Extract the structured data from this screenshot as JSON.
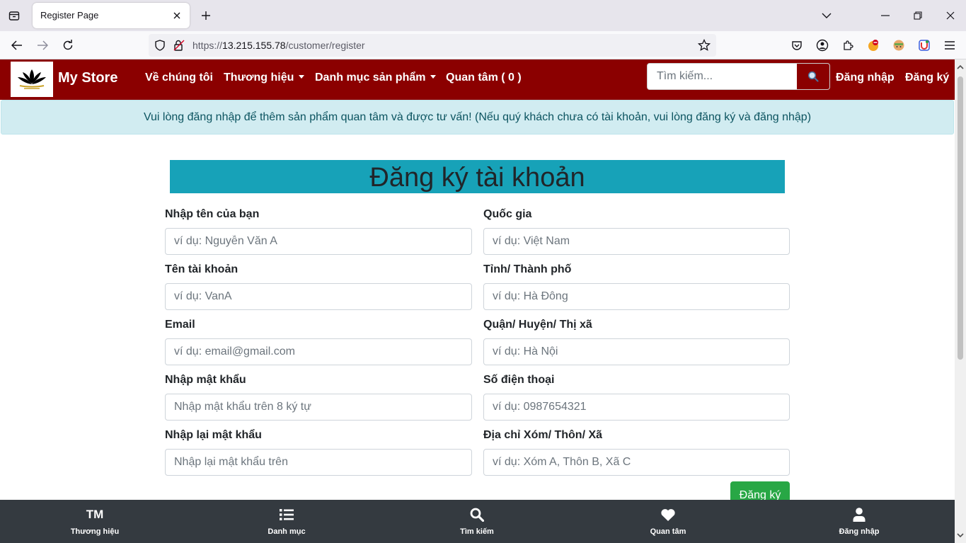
{
  "browser": {
    "tab_title": "Register Page",
    "url_prefix": "https://",
    "url_host": "13.215.155.78",
    "url_path": "/customer/register"
  },
  "site": {
    "brand": "My Store",
    "nav": {
      "about": "Về chúng tôi",
      "brands": "Thương hiệu",
      "categories": "Danh mục sản phẩm",
      "wishlist": "Quan tâm ( 0 )",
      "login": "Đăng nhập",
      "register": "Đăng ký"
    },
    "search": {
      "placeholder": "Tìm kiếm..."
    },
    "colors": {
      "nav_bg": "#8b0000",
      "title_bg": "#17a2b8",
      "submit": "#28a745",
      "bottom_bar": "#343a40"
    }
  },
  "alert": {
    "text": "Vui lòng đăng nhập để thêm sản phẩm quan tâm và được tư vấn! (Nếu quý khách chưa có tài khoản, vui lòng đăng ký và đăng nhập)"
  },
  "form": {
    "title": "Đăng ký tài khoản",
    "fields": [
      {
        "label": "Nhập tên của bạn",
        "placeholder": "ví dụ: Nguyễn Văn A"
      },
      {
        "label": "Quốc gia",
        "placeholder": "ví dụ: Việt Nam"
      },
      {
        "label": "Tên tài khoản",
        "placeholder": "ví dụ: VanA"
      },
      {
        "label": "Tỉnh/ Thành phố",
        "placeholder": "ví dụ: Hà Đông"
      },
      {
        "label": "Email",
        "placeholder": "ví dụ: email@gmail.com"
      },
      {
        "label": "Quận/ Huyện/ Thị xã",
        "placeholder": "ví dụ: Hà Nội"
      },
      {
        "label": "Nhập mật khẩu",
        "placeholder": "Nhập mật khẩu trên 8 ký tự"
      },
      {
        "label": "Số điện thoại",
        "placeholder": "ví dụ: 0987654321"
      },
      {
        "label": "Nhập lại mật khẩu",
        "placeholder": "Nhập lại mật khẩu trên"
      },
      {
        "label": "Địa chỉ Xóm/ Thôn/ Xã",
        "placeholder": "ví dụ: Xóm A, Thôn B, Xã C"
      }
    ],
    "submit": "Đăng ký"
  },
  "bottom_nav": {
    "brand_icon_text": "TM",
    "items": [
      {
        "label": "Thương hiệu",
        "icon": "tm-icon"
      },
      {
        "label": "Danh mục",
        "icon": "list-icon"
      },
      {
        "label": "Tìm kiếm",
        "icon": "search-icon"
      },
      {
        "label": "Quan tâm",
        "icon": "heart-icon"
      },
      {
        "label": "Đăng nhập",
        "icon": "user-icon"
      }
    ]
  }
}
